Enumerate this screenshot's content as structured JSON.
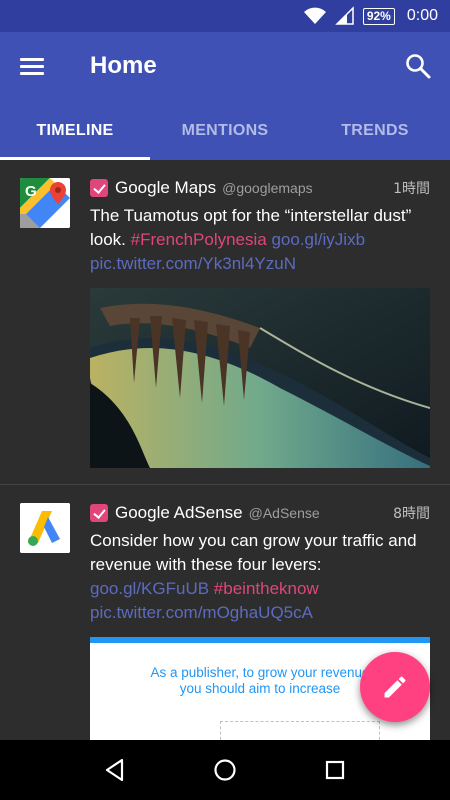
{
  "status_bar": {
    "time": "0:00",
    "battery": "92%"
  },
  "app_bar": {
    "title": "Home"
  },
  "tabs": [
    {
      "label": "TIMELINE",
      "active": true
    },
    {
      "label": "MENTIONS",
      "active": false
    },
    {
      "label": "TRENDS",
      "active": false
    }
  ],
  "tweets": [
    {
      "name": "Google Maps",
      "handle": "@googlemaps",
      "time": "1時間",
      "text": "The Tuamotus opt for the “interstellar dust” look.",
      "hashtag": "#FrenchPolynesia",
      "link1": "goo.gl/iyJixb",
      "link2": "pic.twitter.com/Yk3nl4YzuN"
    },
    {
      "name": "Google AdSense",
      "handle": "@AdSense",
      "time": "8時間",
      "text": "Consider how you can grow your traffic and revenue with these four levers:",
      "link1": "goo.gl/KGFuUB",
      "hashtag": "#beintheknow",
      "link2": "pic.twitter.com/mOghaUQ5cA",
      "media_line1": "As a publisher, to grow your revenue",
      "media_line2": "you should aim to increase"
    }
  ],
  "colors": {
    "primary": "#3f51b5",
    "primary_dark": "#303f9f",
    "accent": "#ff4081",
    "link": "#5c6bc0",
    "hashtag": "#e0457b"
  },
  "icons": {
    "menu": "menu-icon",
    "search": "search-icon",
    "compose": "pencil-icon",
    "back": "back-icon",
    "home": "home-icon",
    "recents": "recents-icon"
  }
}
